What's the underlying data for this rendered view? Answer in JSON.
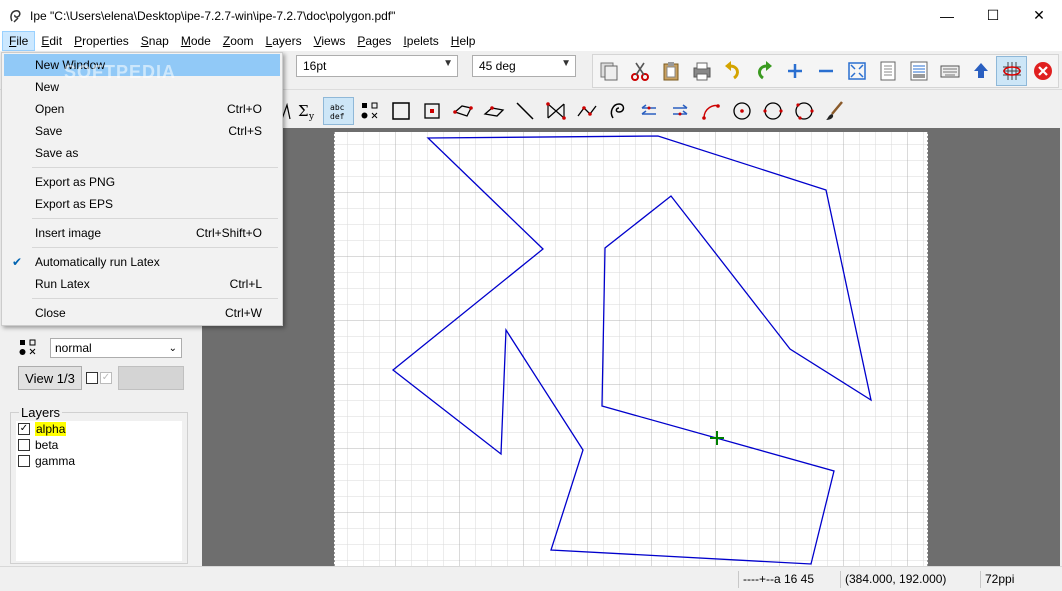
{
  "window": {
    "title": "Ipe \"C:\\Users\\elena\\Desktop\\ipe-7.2.7-win\\ipe-7.2.7\\doc\\polygon.pdf\"",
    "minimize": "—",
    "maximize": "☐",
    "close": "✕"
  },
  "menubar": [
    {
      "label": "File",
      "key": "F",
      "rest": "ile"
    },
    {
      "label": "Edit",
      "key": "E",
      "rest": "dit"
    },
    {
      "label": "Properties",
      "key": "P",
      "rest": "roperties"
    },
    {
      "label": "Snap",
      "key": "S",
      "rest": "nap"
    },
    {
      "label": "Mode",
      "key": "M",
      "rest": "ode"
    },
    {
      "label": "Zoom",
      "key": "Z",
      "rest": "oom"
    },
    {
      "label": "Layers",
      "key": "L",
      "rest": "ayers"
    },
    {
      "label": "Views",
      "key": "V",
      "rest": "iews"
    },
    {
      "label": "Pages",
      "key": "P",
      "rest": "ages"
    },
    {
      "label": "Ipelets",
      "key": "I",
      "rest": "pelets"
    },
    {
      "label": "Help",
      "key": "H",
      "rest": "elp"
    }
  ],
  "toolbar": {
    "snap_size": "16pt",
    "angle": "45 deg"
  },
  "file_menu": {
    "watermark": "SOFTPEDIA",
    "items": [
      {
        "label": "New Window",
        "shortcut": ""
      },
      {
        "label": "New",
        "shortcut": ""
      },
      {
        "label": "Open",
        "shortcut": "Ctrl+O"
      },
      {
        "label": "Save",
        "shortcut": "Ctrl+S"
      },
      {
        "label": "Save as",
        "shortcut": ""
      },
      {
        "label": "Export as PNG",
        "shortcut": ""
      },
      {
        "label": "Export as EPS",
        "shortcut": ""
      },
      {
        "label": "Insert image",
        "shortcut": "Ctrl+Shift+O"
      },
      {
        "label": "Automatically run Latex",
        "shortcut": "",
        "checked": true
      },
      {
        "label": "Run Latex",
        "shortcut": "Ctrl+L"
      },
      {
        "label": "Close",
        "shortcut": "Ctrl+W"
      }
    ]
  },
  "properties": {
    "symbol_size": "normal",
    "view_button": "View 1/3"
  },
  "layers": {
    "title": "Layers",
    "items": [
      {
        "name": "alpha",
        "checked": true,
        "active": true
      },
      {
        "name": "beta",
        "checked": false,
        "active": false
      },
      {
        "name": "gamma",
        "checked": false,
        "active": false
      }
    ]
  },
  "statusbar": {
    "snap_indicator": "----+--a 16 45",
    "coordinates": "(384.000, 192.000)",
    "resolution": "72ppi"
  },
  "colors": {
    "polygon_stroke": "#0000cc",
    "cursor_cross": "#008000",
    "grid_line": "#d8d8d8",
    "canvas_background": "#6e6e6e",
    "menu_highlight": "#91c9f7",
    "layer_highlight": "#ffff00"
  }
}
